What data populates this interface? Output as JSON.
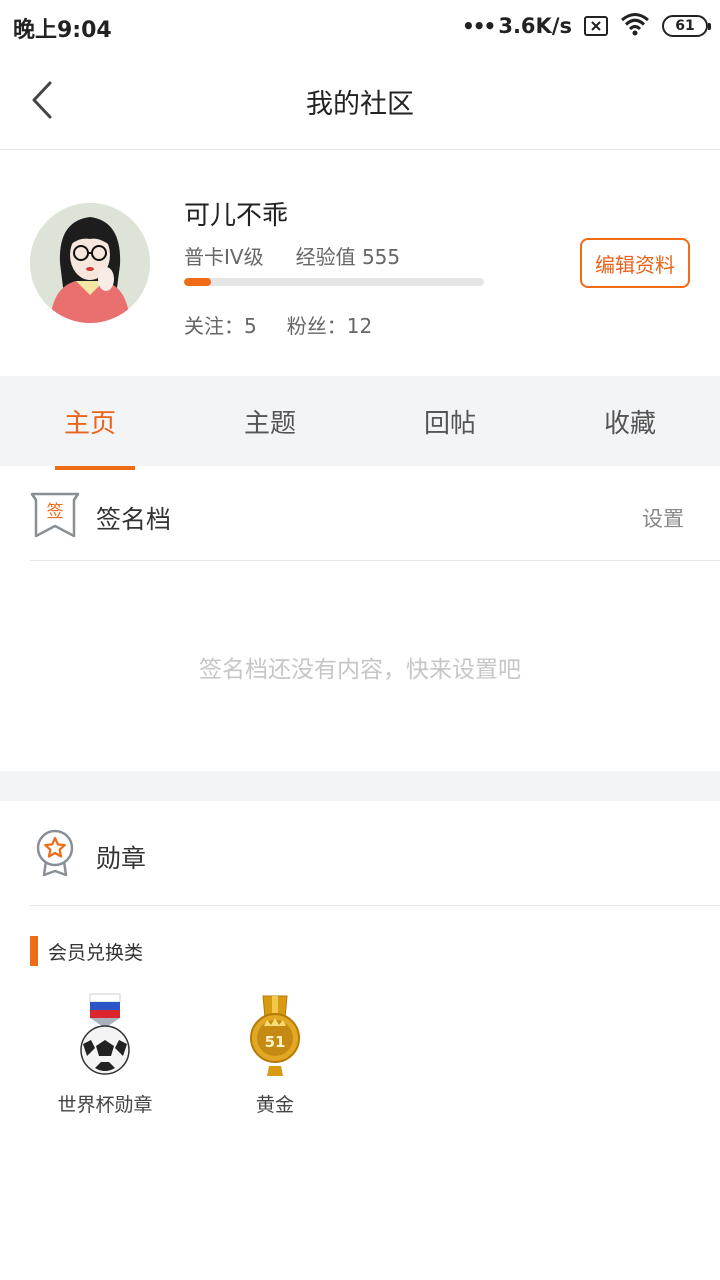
{
  "status_bar": {
    "time": "晚上9:04",
    "net_speed": "3.6K/s",
    "battery": "61",
    "icons": [
      "signal-dots-icon",
      "sim-x-icon",
      "wifi-icon",
      "battery-icon"
    ]
  },
  "header": {
    "title": "我的社区",
    "back_icon": "back-chevron-icon"
  },
  "profile": {
    "username": "可儿不乖",
    "level": "普卡IV级",
    "experience": "经验值 555",
    "xp_progress": 0.09,
    "following": "关注：5",
    "fans": "粉丝：12",
    "edit_label": "编辑资料"
  },
  "tabs": [
    {
      "label": "主页",
      "active": true
    },
    {
      "label": "主题",
      "active": false
    },
    {
      "label": "回帖",
      "active": false
    },
    {
      "label": "收藏",
      "active": false
    }
  ],
  "signature": {
    "icon_text": "签",
    "title": "签名档",
    "setting_label": "设置",
    "empty_text": "签名档还没有内容，快来设置吧"
  },
  "medals": {
    "title": "勋章",
    "category": "会员兑换类",
    "items": [
      {
        "name": "世界杯勋章",
        "icon": "world-cup-medal-icon"
      },
      {
        "name": "黄金",
        "icon": "gold-medal-icon",
        "number": "51"
      }
    ]
  },
  "colors": {
    "accent": "#f06b16",
    "accent_text": "#e8631b",
    "band": "#f3f4f6",
    "muted": "#c6c6c6"
  }
}
